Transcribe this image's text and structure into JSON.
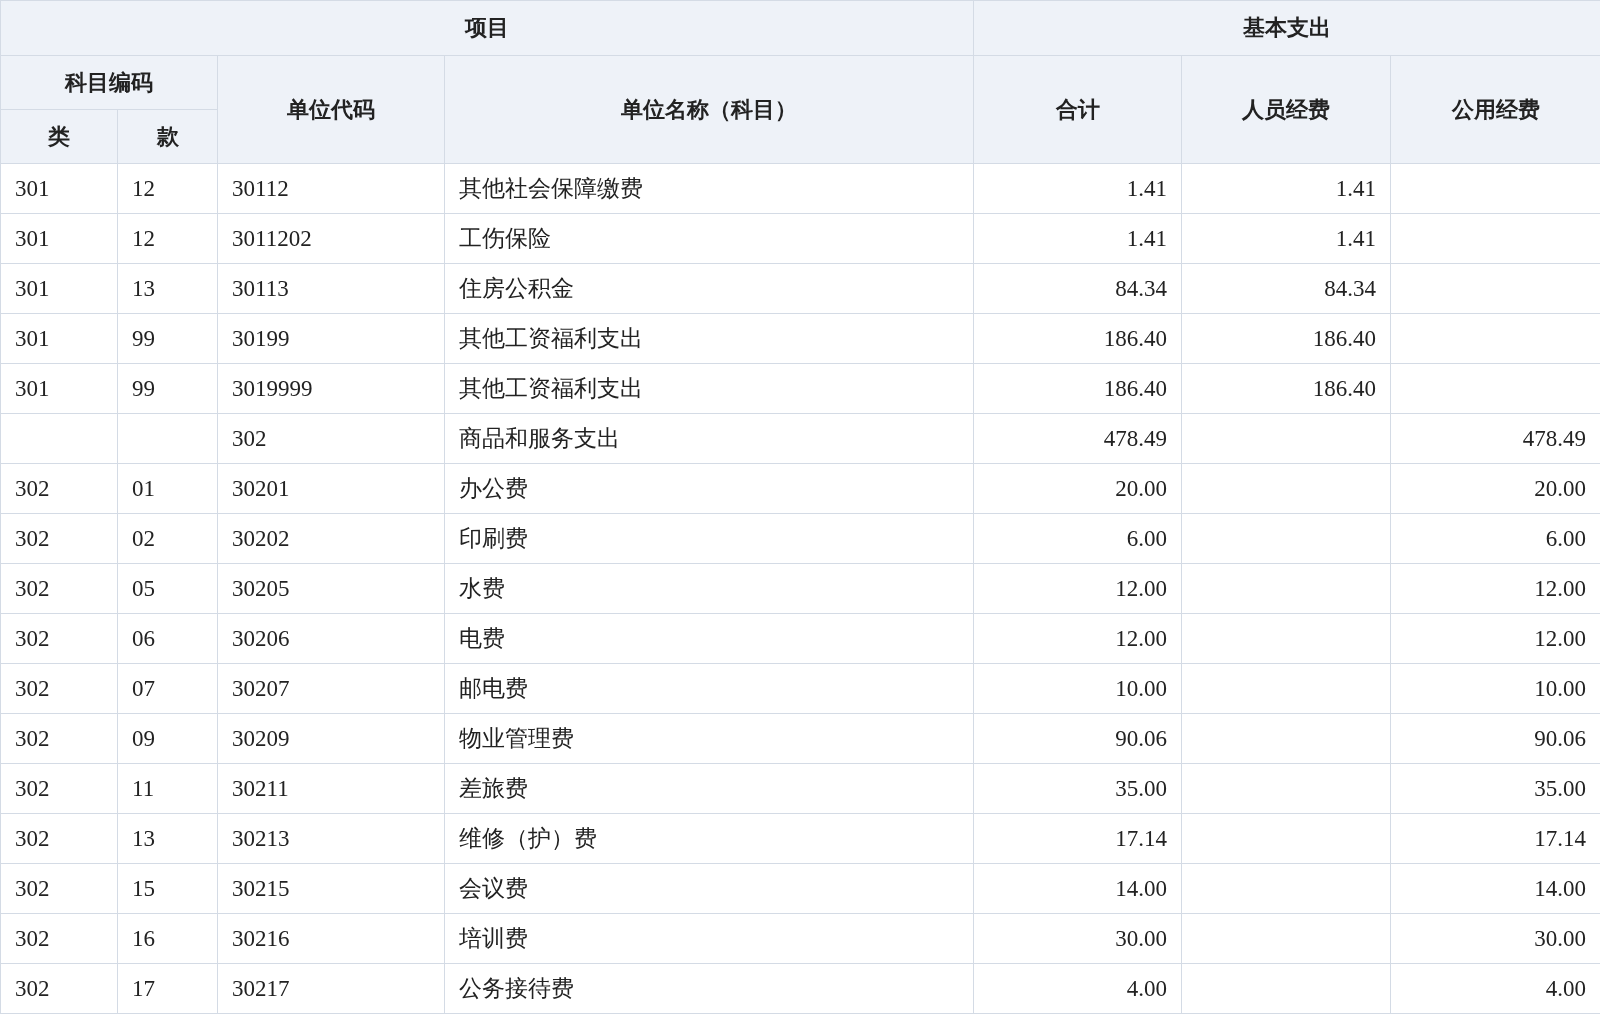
{
  "header": {
    "group_left": "项目",
    "group_right": "基本支出",
    "subject_code": "科目编码",
    "class": "类",
    "item": "款",
    "unit_code": "单位代码",
    "unit_name": "单位名称（科目）",
    "total": "合计",
    "personnel": "人员经费",
    "public": "公用经费"
  },
  "rows": [
    {
      "class": "301",
      "item": "12",
      "code": "30112",
      "name": "其他社会保障缴费",
      "total": "1.41",
      "personnel": "1.41"
    },
    {
      "class": "301",
      "item": "12",
      "code": "3011202",
      "name": "工伤保险",
      "total": "1.41",
      "personnel": "1.41"
    },
    {
      "class": "301",
      "item": "13",
      "code": "30113",
      "name": "住房公积金",
      "total": "84.34",
      "personnel": "84.34"
    },
    {
      "class": "301",
      "item": "99",
      "code": "30199",
      "name": "其他工资福利支出",
      "total": "186.40",
      "personnel": "186.40"
    },
    {
      "class": "301",
      "item": "99",
      "code": "3019999",
      "name": "其他工资福利支出",
      "total": "186.40",
      "personnel": "186.40"
    },
    {
      "code": "302",
      "name": "商品和服务支出",
      "total": "478.49",
      "public": "478.49"
    },
    {
      "class": "302",
      "item": "01",
      "code": "30201",
      "name": "办公费",
      "total": "20.00",
      "public": "20.00"
    },
    {
      "class": "302",
      "item": "02",
      "code": "30202",
      "name": "印刷费",
      "total": "6.00",
      "public": "6.00"
    },
    {
      "class": "302",
      "item": "05",
      "code": "30205",
      "name": "水费",
      "total": "12.00",
      "public": "12.00"
    },
    {
      "class": "302",
      "item": "06",
      "code": "30206",
      "name": "电费",
      "total": "12.00",
      "public": "12.00"
    },
    {
      "class": "302",
      "item": "07",
      "code": "30207",
      "name": "邮电费",
      "total": "10.00",
      "public": "10.00"
    },
    {
      "class": "302",
      "item": "09",
      "code": "30209",
      "name": "物业管理费",
      "total": "90.06",
      "public": "90.06"
    },
    {
      "class": "302",
      "item": "11",
      "code": "30211",
      "name": "差旅费",
      "total": "35.00",
      "public": "35.00"
    },
    {
      "class": "302",
      "item": "13",
      "code": "30213",
      "name": "维修（护）费",
      "total": "17.14",
      "public": "17.14"
    },
    {
      "class": "302",
      "item": "15",
      "code": "30215",
      "name": "会议费",
      "total": "14.00",
      "public": "14.00"
    },
    {
      "class": "302",
      "item": "16",
      "code": "30216",
      "name": "培训费",
      "total": "30.00",
      "public": "30.00"
    },
    {
      "class": "302",
      "item": "17",
      "code": "30217",
      "name": "公务接待费",
      "total": "4.00",
      "public": "4.00"
    }
  ]
}
